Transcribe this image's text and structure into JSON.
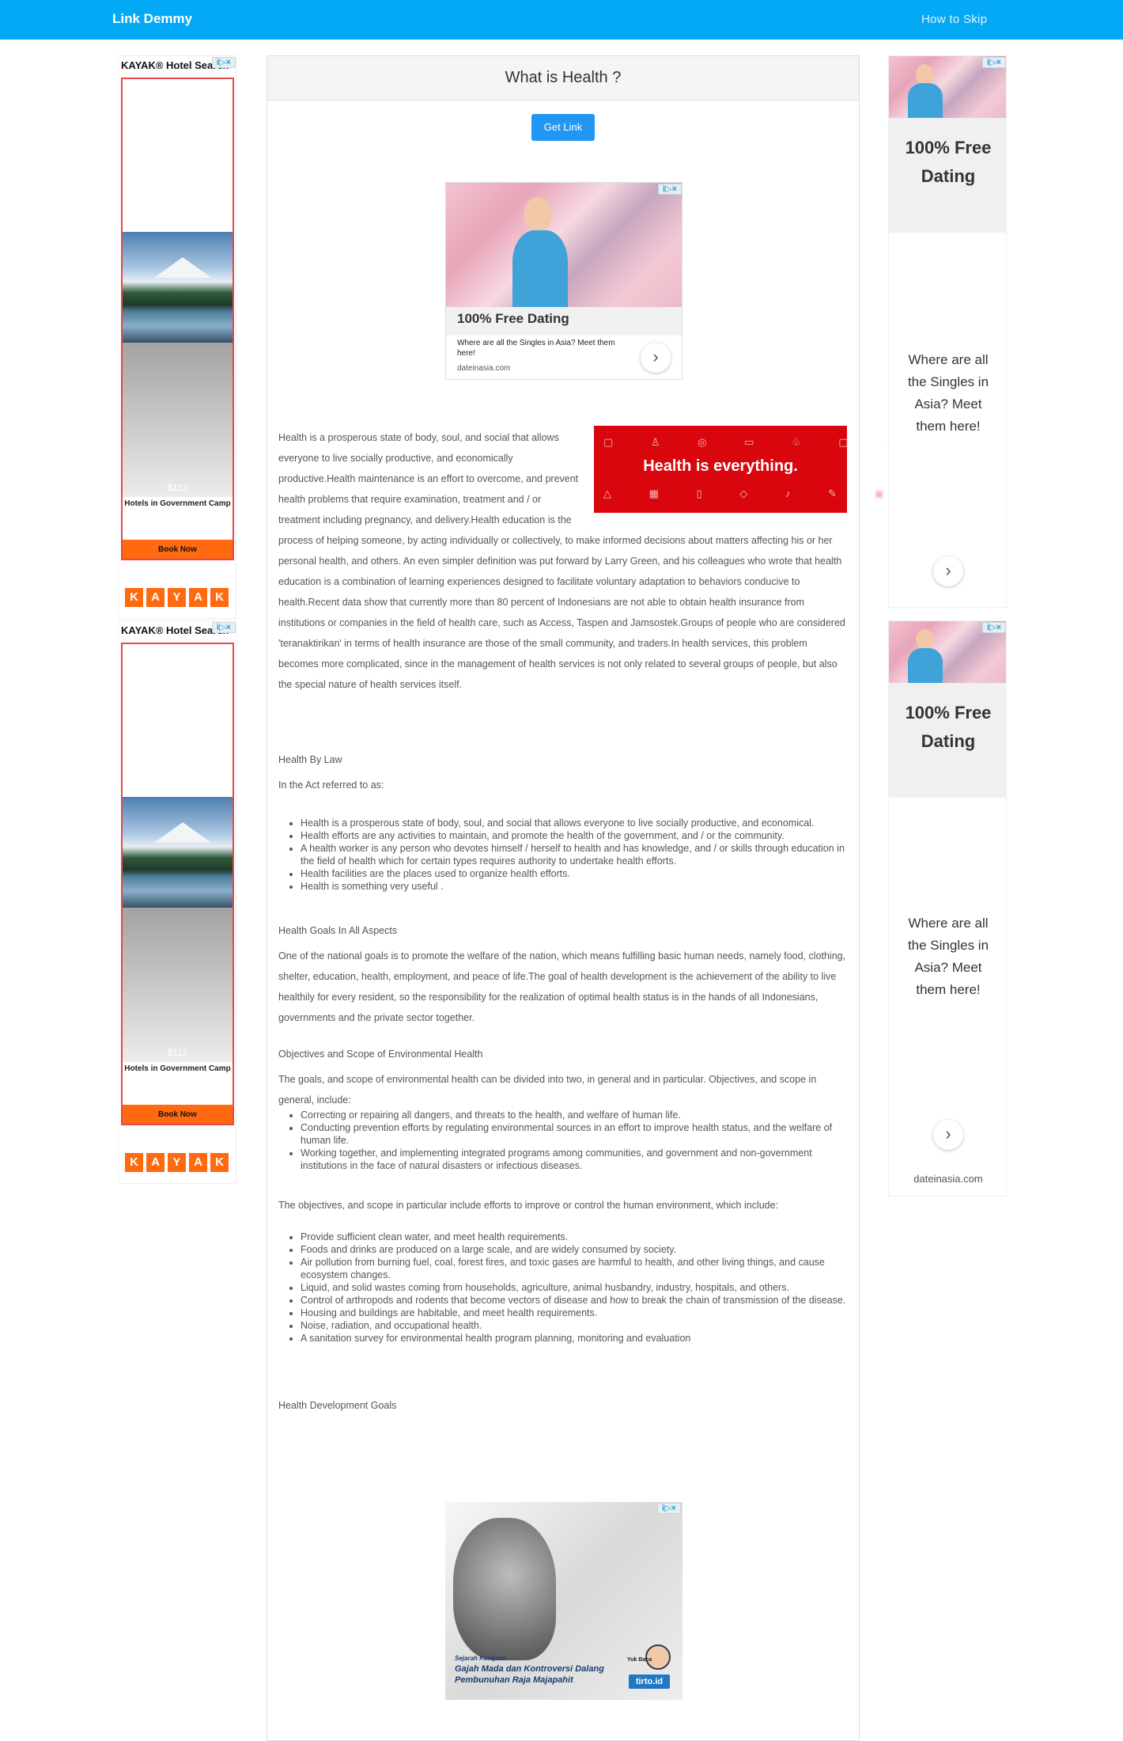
{
  "header": {
    "brand": "Link Demmy",
    "nav_link": "How to Skip"
  },
  "kayak_ad": {
    "title": "KAYAK® Hotel Search",
    "price": "$112",
    "hotel": "Hotels in Government Camp",
    "cta": "Book Now",
    "logo_letters": [
      "K",
      "A",
      "Y",
      "A",
      "K"
    ],
    "accent_color": "#ff690f"
  },
  "adchoices": "i▷×",
  "main": {
    "title": "What is Health ?",
    "get_link": "Get Link",
    "dating_ad": {
      "headline": "100% Free Dating",
      "text": "Where are all the Singles in Asia? Meet them here!",
      "domain": "dateinasia.com"
    },
    "banner_text": "Health is everything.",
    "intro": "Health is a prosperous state of body, soul, and social that allows everyone to live socially productive, and economically productive.Health maintenance is an effort to overcome, and prevent health problems that require examination, treatment and / or treatment including pregnancy, and delivery.Health education is the process of helping someone, by acting individually or collectively, to make informed decisions about matters affecting his or her personal health, and others. An even simpler definition was put forward by Larry Green, and his colleagues who wrote that health education is a combination of learning experiences designed to facilitate voluntary adaptation to behaviors conducive to health.Recent data show that currently more than 80 percent of Indonesians are not able to obtain health insurance from institutions or companies in the field of health care, such as Access, Taspen and Jamsostek.Groups of people who are considered 'teranaktirikan' in terms of health insurance are those of the small community, and traders.In health services, this problem becomes more complicated, since in the management of health services is not only related to several groups of people, but also the special nature of health services itself.",
    "law_heading": "Health By Law",
    "law_intro": "In the Act referred to as:",
    "law_items": [
      "Health is a prosperous state of body, soul, and social that allows everyone to live socially productive, and economical.",
      "Health efforts are any activities to maintain, and promote the health of the government, and / or the community.",
      "A health worker is any person who devotes himself / herself to health and has knowledge, and / or skills through education in the field of health which for certain types requires authority to undertake health efforts.",
      "Health facilities are the places used to organize health efforts.",
      "Health is something very useful ."
    ],
    "goals_heading": "Health Goals In All Aspects",
    "goals_text": "One of the national goals is to promote the welfare of the nation, which means fulfilling basic human needs, namely food, clothing, shelter, education, health, employment, and peace of life.The goal of health development is the achievement of the ability to live healthily for every resident, so the responsibility for the realization of optimal health status is in the hands of all Indonesians, governments and the private sector together.",
    "env_heading": "Objectives and Scope of Environmental Health",
    "env_text": "The goals, and scope of environmental health can be divided into two, in general and in particular.  Objectives, and scope in general, include:",
    "env_items": [
      "Correcting or repairing all dangers, and threats to the health, and welfare of human life.",
      "Conducting prevention efforts by regulating environmental sources in an effort to improve health status, and the welfare of human life.",
      "Working together, and implementing integrated programs among communities, and government and non-government institutions in the face of natural disasters or infectious diseases."
    ],
    "particular_text": "The objectives, and scope in particular include efforts to improve or control the human environment, which include:",
    "particular_items": [
      "Provide sufficient clean water, and meet health requirements.",
      "Foods and drinks are produced on a large scale, and are widely consumed by society.",
      "Air pollution from burning fuel, coal, forest fires, and toxic gases are harmful to health, and other living things, and cause ecosystem changes.",
      "Liquid, and solid wastes coming from households, agriculture, animal husbandry, industry, hospitals, and others.",
      "Control of arthropods and rodents that become vectors of disease and how to break the chain of transmission of the disease.",
      "Housing and buildings are habitable, and meet health requirements.",
      "Noise, radiation, and occupational health.",
      "A sanitation survey for environmental health program planning, monitoring and evaluation"
    ],
    "dev_heading": "Health Development Goals",
    "tirto_ad": {
      "kicker": "Sejarah Kerajaan",
      "headline": "Gajah Mada dan Kontroversi Dalang Pembunuhan Raja Majapahit",
      "cta": "Yuk Baca",
      "logo": "tirto.id"
    }
  },
  "right_ad": {
    "headline": "100% Free Dating",
    "text": "Where are all the Singles in Asia? Meet them here!",
    "domain": "dateinasia.com"
  }
}
